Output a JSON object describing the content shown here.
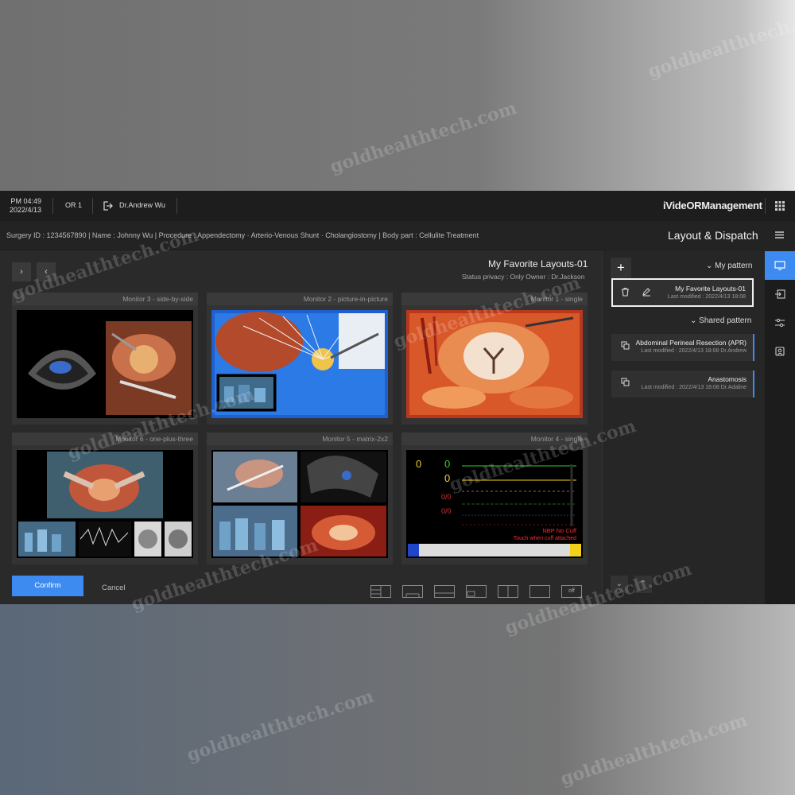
{
  "topbar": {
    "time": "PM 04:49",
    "date": "2022/4/13",
    "room": "OR 1",
    "user": "Dr.Andrew Wu",
    "brand": "iVideORManagement"
  },
  "infobar": {
    "patient_info": "Surgery ID : 1234567890  |  Name : Johnny Wu  |  Procedure : Appendectomy · Arterio-Venous Shunt · Cholangiostomy  |  Body part : Cellulite Treatment",
    "page_title": "Layout & Dispatch"
  },
  "layout": {
    "name": "My Favorite Layouts-01",
    "status": "Status privacy : Only Owner : Dr.Jackson"
  },
  "monitors": [
    {
      "label": "Monitor 1 - single"
    },
    {
      "label": "Monitor 2 - picture-in-picture"
    },
    {
      "label": "Monitor 3 - side-by-side"
    },
    {
      "label": "Monitor 4 - single"
    },
    {
      "label": "Monitor 5 - matrix-2x2"
    },
    {
      "label": "Monitor 6 - one-plus-three"
    }
  ],
  "monitor4_alert": {
    "line1": "NBP No Cuff",
    "line2": "Touch when cuff attached"
  },
  "layout_options": {
    "off_label": "off"
  },
  "actions": {
    "cancel": "Cancel",
    "confirm": "Confirm"
  },
  "patterns": {
    "my_pattern_label": "My pattern",
    "shared_pattern_label": "Shared pattern",
    "my_items": [
      {
        "title": "My Favorite Layouts-01",
        "meta": "Last modified : 2022/4/13 18:08"
      }
    ],
    "shared_items": [
      {
        "title": "Abdominal Perineal Resection (APR)",
        "meta": "Last modified : 2022/4/13 18:08 Dr.Andrew"
      },
      {
        "title": "Anastomosis",
        "meta": "Last modified : 2022/4/13 18:08 Dr.Adaline"
      }
    ]
  },
  "watermark": "goldhealthtech.com",
  "colors": {
    "accent": "#3d8bf0",
    "app_bg": "#2a2a2a",
    "topbar_bg": "#1d1d1d"
  }
}
